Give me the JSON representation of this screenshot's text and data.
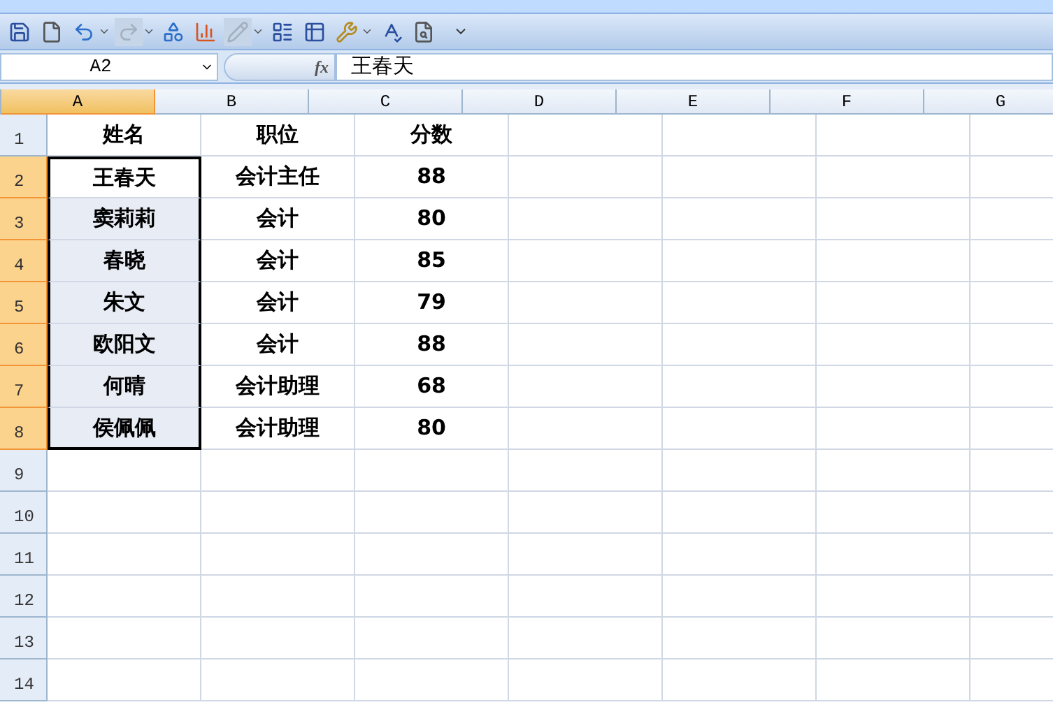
{
  "toolbar": [
    {
      "kind": "save",
      "disabled": false
    },
    {
      "kind": "new",
      "disabled": false
    },
    {
      "kind": "undo",
      "disabled": false,
      "dropdown": true
    },
    {
      "kind": "redo",
      "disabled": true,
      "dropdown": true
    },
    {
      "kind": "shapes",
      "disabled": false
    },
    {
      "kind": "chart",
      "disabled": false
    },
    {
      "kind": "draw",
      "disabled": true,
      "dropdown": true
    },
    {
      "kind": "form",
      "disabled": false
    },
    {
      "kind": "pivot",
      "disabled": false
    },
    {
      "kind": "tools",
      "disabled": false,
      "dropdown": true
    },
    {
      "kind": "spell",
      "disabled": false
    },
    {
      "kind": "preview",
      "disabled": false
    },
    {
      "kind": "customize"
    }
  ],
  "name_box": "A2",
  "fx_label": "fx",
  "formula": "王春天",
  "columns": [
    {
      "label": "A",
      "selected": true
    },
    {
      "label": "B",
      "selected": false
    },
    {
      "label": "C",
      "selected": false
    },
    {
      "label": "D",
      "selected": false
    },
    {
      "label": "E",
      "selected": false
    },
    {
      "label": "F",
      "selected": false
    },
    {
      "label": "G",
      "selected": false
    }
  ],
  "rows": [
    {
      "number": "1",
      "selected": false,
      "active": false,
      "cells": [
        "姓名",
        "职位",
        "分数"
      ]
    },
    {
      "number": "2",
      "selected": true,
      "active": true,
      "cells": [
        "王春天",
        "会计主任",
        "88"
      ]
    },
    {
      "number": "3",
      "selected": true,
      "active": false,
      "cells": [
        "窦莉莉",
        "会计",
        "80"
      ]
    },
    {
      "number": "4",
      "selected": true,
      "active": false,
      "cells": [
        "春晓",
        "会计",
        "85"
      ]
    },
    {
      "number": "5",
      "selected": true,
      "active": false,
      "cells": [
        "朱文",
        "会计",
        "79"
      ]
    },
    {
      "number": "6",
      "selected": true,
      "active": false,
      "cells": [
        "欧阳文",
        "会计",
        "88"
      ]
    },
    {
      "number": "7",
      "selected": true,
      "active": false,
      "cells": [
        "何晴",
        "会计助理",
        "68"
      ]
    },
    {
      "number": "8",
      "selected": true,
      "active": false,
      "cells": [
        "侯佩佩",
        "会计助理",
        "80"
      ]
    },
    {
      "number": "9",
      "selected": false,
      "active": false,
      "cells": []
    },
    {
      "number": "10",
      "selected": false,
      "active": false,
      "cells": []
    },
    {
      "number": "11",
      "selected": false,
      "active": false,
      "cells": []
    },
    {
      "number": "12",
      "selected": false,
      "active": false,
      "cells": []
    },
    {
      "number": "13",
      "selected": false,
      "active": false,
      "cells": []
    },
    {
      "number": "14",
      "selected": false,
      "active": false,
      "cells": []
    }
  ]
}
